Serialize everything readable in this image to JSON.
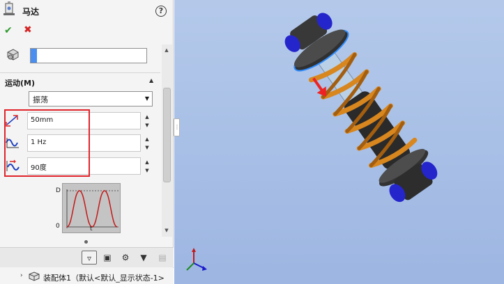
{
  "panel": {
    "title": "马达",
    "help_icon": "help-icon",
    "ok_icon": "checkmark-icon",
    "cancel_icon": "close-icon",
    "component": {
      "value": ""
    },
    "motion_section": {
      "title": "运动(M)",
      "motion_type": "振荡",
      "amplitude": "50mm",
      "frequency": "1 Hz",
      "phase": "90度"
    },
    "graph": {
      "y_label_top": "D",
      "y_label_bottom": "0",
      "x_label": "t"
    },
    "assembly": {
      "text": "装配体1（默认<默认_显示状态-1>"
    }
  },
  "colors": {
    "viewport_bg": "#a9c0e6",
    "spring": "#d8861e",
    "highlight": "#e0242b",
    "accent": "#4a8ef0",
    "end_cap": "#2a2ad6"
  }
}
